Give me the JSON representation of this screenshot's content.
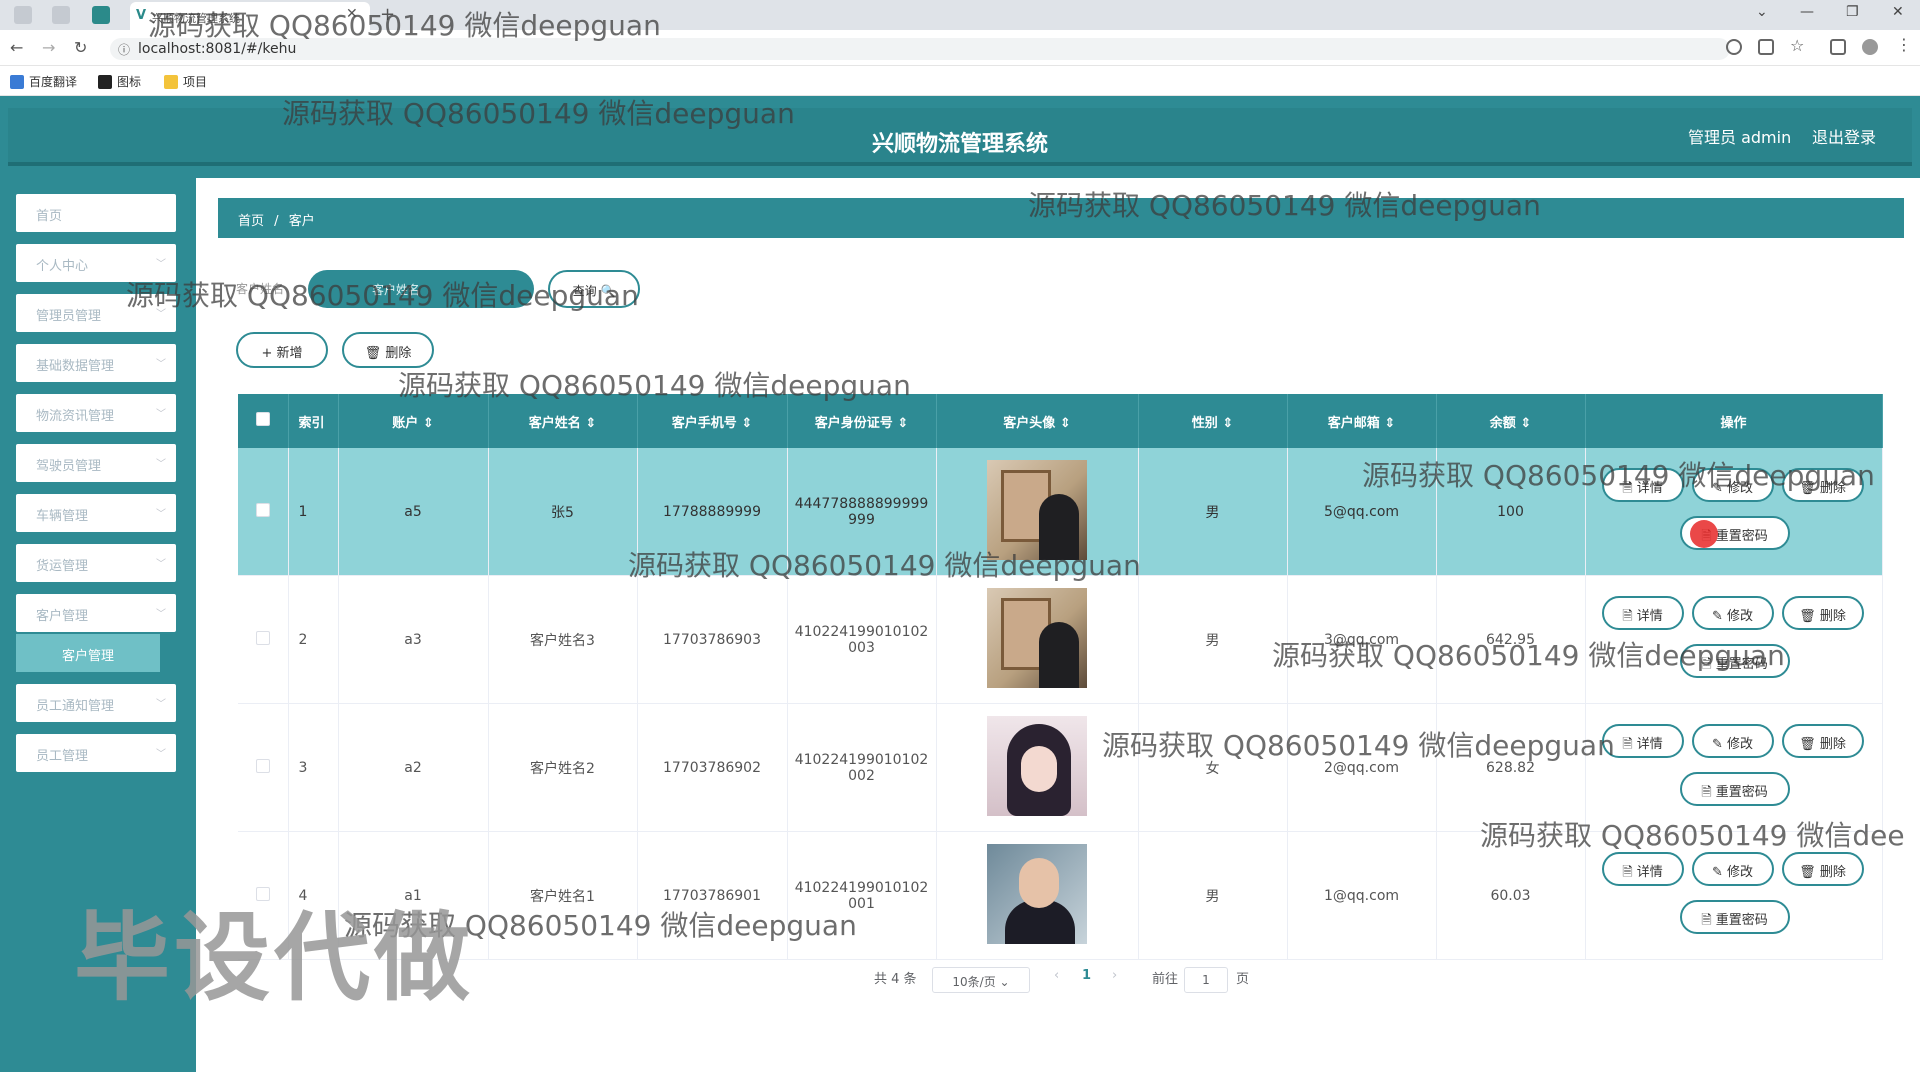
{
  "browser": {
    "tab_title": "兴顺物流管理系统",
    "url": "localhost:8081/#/kehu",
    "bookmarks": [
      "百度翻译",
      "图标",
      "项目"
    ]
  },
  "header": {
    "title": "兴顺物流管理系统",
    "user_label": "管理员 admin",
    "logout_label": "退出登录"
  },
  "sidebar": {
    "items": [
      "首页",
      "个人中心",
      "管理员管理",
      "基础数据管理",
      "物流资讯管理",
      "驾驶员管理",
      "车辆管理",
      "货运管理",
      "客户管理"
    ],
    "active_sub": "客户管理",
    "items_after": [
      "员工通知管理",
      "员工管理"
    ]
  },
  "breadcrumb": {
    "home": "首页",
    "sep": "/",
    "current": "客户"
  },
  "search": {
    "label": "客户姓名",
    "placeholder": "客户姓名",
    "query_label": "查询"
  },
  "actions": {
    "add_label": "+ 新增",
    "delete_label": "删除"
  },
  "table": {
    "headers": [
      "索引",
      "账户",
      "客户姓名",
      "客户手机号",
      "客户身份证号",
      "客户头像",
      "性别",
      "客户邮箱",
      "余额",
      "操作"
    ],
    "rows": [
      {
        "index": "1",
        "account": "a5",
        "name": "张5",
        "phone": "17788889999",
        "id1": "444778888899999",
        "id2": "999",
        "gender": "男",
        "email": "5@qq.com",
        "balance": "100"
      },
      {
        "index": "2",
        "account": "a3",
        "name": "客户姓名3",
        "phone": "17703786903",
        "id1": "410224199010102",
        "id2": "003",
        "gender": "男",
        "email": "3@qq.com",
        "balance": "642.95"
      },
      {
        "index": "3",
        "account": "a2",
        "name": "客户姓名2",
        "phone": "17703786902",
        "id1": "410224199010102",
        "id2": "002",
        "gender": "女",
        "email": "2@qq.com",
        "balance": "628.82"
      },
      {
        "index": "4",
        "account": "a1",
        "name": "客户姓名1",
        "phone": "17703786901",
        "id1": "410224199010102",
        "id2": "001",
        "gender": "男",
        "email": "1@qq.com",
        "balance": "60.03"
      }
    ],
    "op_labels": {
      "detail": "详情",
      "edit": "修改",
      "delete": "删除",
      "reset": "重置密码"
    }
  },
  "pagination": {
    "total": "共 4 条",
    "page_size": "10条/页",
    "current": "1",
    "goto_prefix": "前往",
    "goto_value": "1",
    "goto_suffix": "页"
  },
  "watermarks": {
    "text": "源码获取 QQ86050149 微信deepguan",
    "text_cut": "源码获取 QQ86050149 微信dee",
    "big": "毕设代做"
  },
  "colors": {
    "primary": "#2e8b94",
    "highlight_row": "#8fd3d8",
    "submenu_active": "#6fc0c6"
  }
}
